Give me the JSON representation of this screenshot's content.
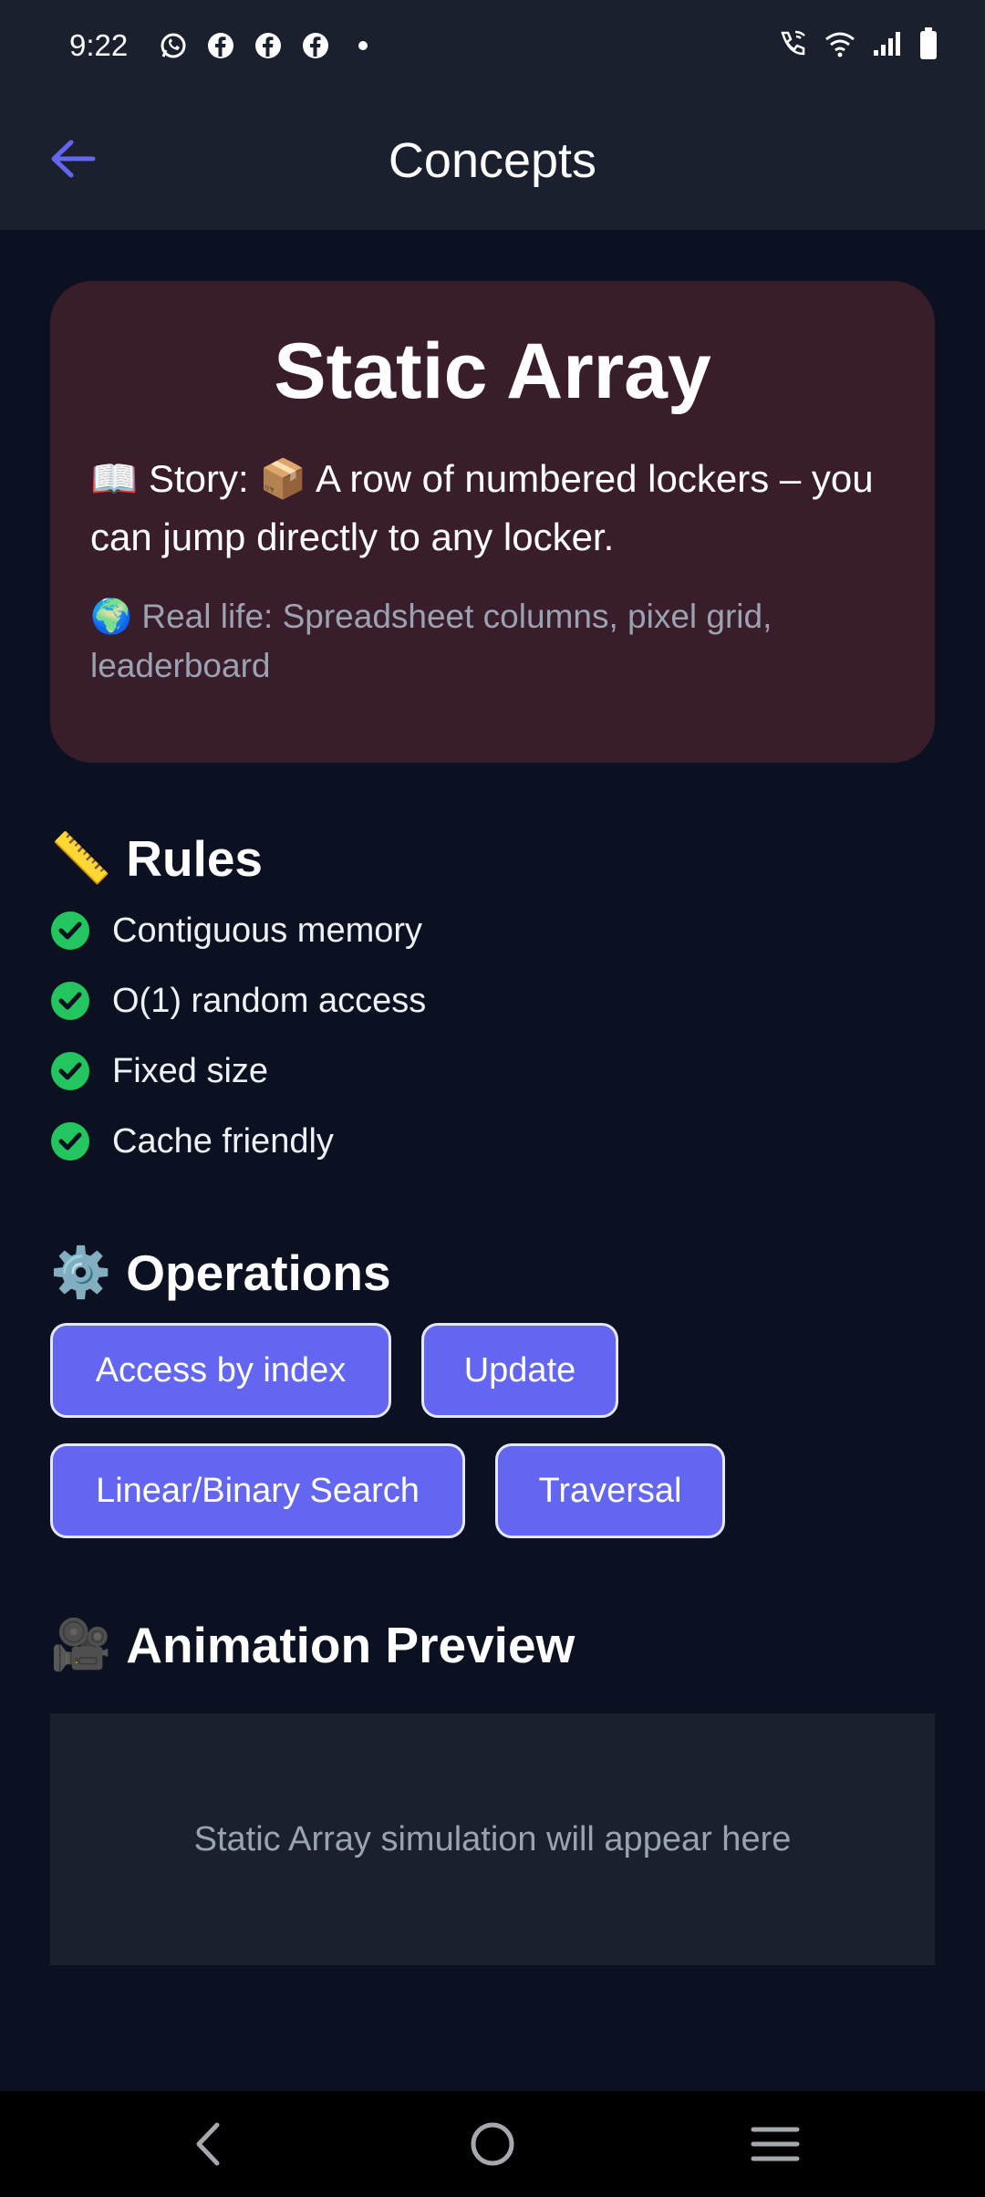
{
  "status_bar": {
    "time": "9:22",
    "left_icons": [
      "whatsapp-icon",
      "facebook-icon",
      "facebook-icon",
      "facebook-icon",
      "dot-icon"
    ],
    "right_icons": [
      "wifi-calling-icon",
      "wifi-icon",
      "signal-icon",
      "battery-icon"
    ]
  },
  "app_bar": {
    "title": "Concepts",
    "back_icon": "arrow-left-icon",
    "accent_color": "#6366f1"
  },
  "hero": {
    "title": "Static Array",
    "story": "📖 Story: 📦 A row of numbered lockers – you can jump directly to any locker.",
    "real_life": "🌍 Real life: Spreadsheet columns, pixel grid, leaderboard",
    "background_color": "#3a1d2a"
  },
  "rules": {
    "emoji": "📏",
    "title": "Rules",
    "items": [
      "Contiguous memory",
      "O(1) random access",
      "Fixed size",
      "Cache friendly"
    ],
    "check_color": "#22c55e"
  },
  "operations": {
    "emoji": "⚙️",
    "title": "Operations",
    "buttons": [
      "Access by index",
      "Update",
      "Linear/Binary Search",
      "Traversal"
    ],
    "button_color": "#6366f1"
  },
  "animation": {
    "emoji": "🎥",
    "title": "Animation Preview",
    "placeholder": "Static Array simulation will appear here"
  },
  "nav_bar": {
    "icons": [
      "nav-back-icon",
      "nav-home-icon",
      "nav-recents-icon"
    ]
  }
}
